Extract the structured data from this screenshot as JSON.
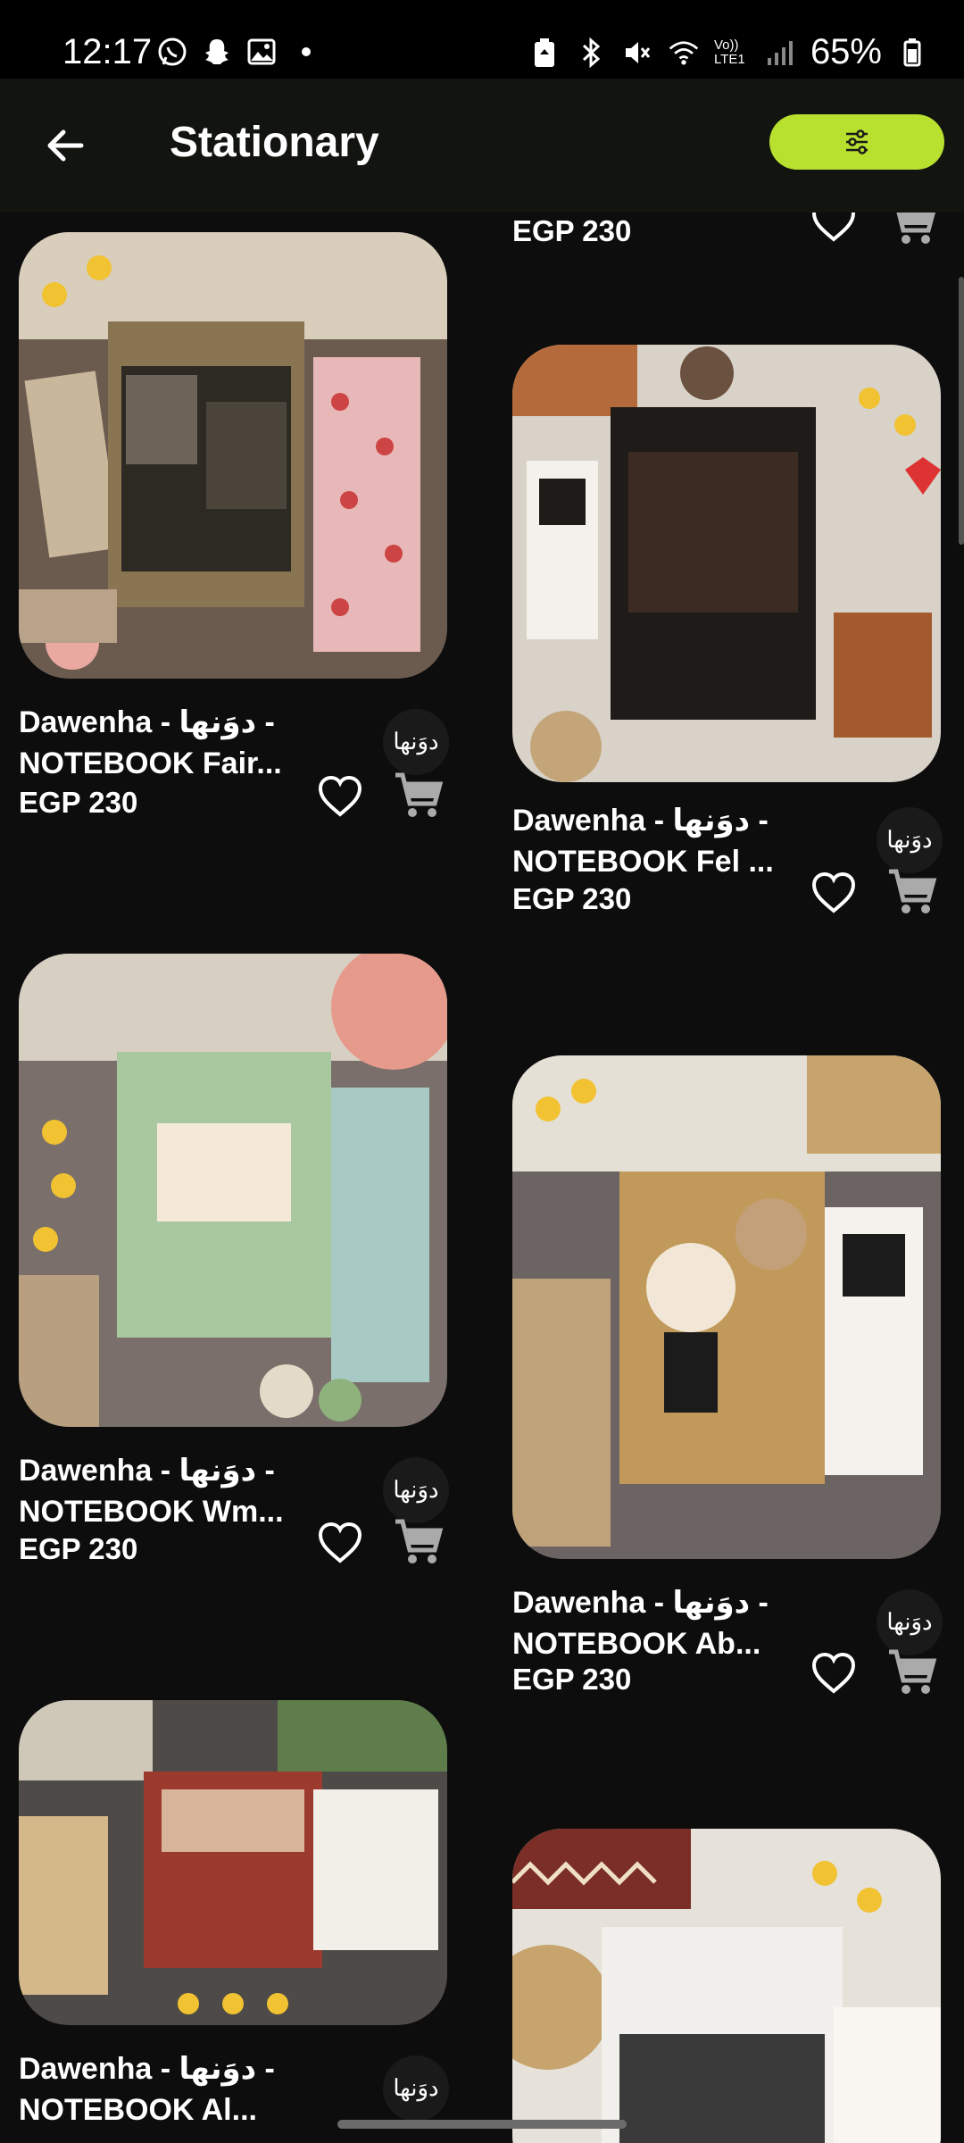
{
  "status_bar": {
    "time": "12:17",
    "left_icons": [
      "whatsapp-icon",
      "snapchat-icon",
      "gallery-icon",
      "dot-icon"
    ],
    "right_icons": [
      "battery-saver-icon",
      "bluetooth-icon",
      "mute-icon",
      "wifi-icon",
      "volte-icon",
      "signal-icon"
    ],
    "volte_label": "Vo)) LTE1",
    "battery": "65%"
  },
  "app_bar": {
    "title": "Stationary",
    "back_icon": "arrow-left-icon",
    "filter_icon": "sliders-icon",
    "accent": "#b8e02f"
  },
  "products": [
    {
      "name_line1": "Dawenha - دوَنها -",
      "name_line2": "NOTEBOOK Fair...",
      "price": "EGP 230",
      "logo_text": "دوَنها"
    },
    {
      "name_line1": "Dawenha - دوَنها -",
      "name_line2": "NOTEBOOK Fel ...",
      "price": "EGP 230",
      "logo_text": "دوَنها"
    },
    {
      "name_line1": "Dawenha - دوَنها -",
      "name_line2": "NOTEBOOK Wm...",
      "price": "EGP 230",
      "logo_text": "دوَنها"
    },
    {
      "name_line1": "Dawenha - دوَنها -",
      "name_line2": "NOTEBOOK  Ab...",
      "price": "EGP 230",
      "logo_text": "دوَنها"
    },
    {
      "name_line1": "Dawenha - دوَنها -",
      "name_line2": "NOTEBOOK Al...",
      "price": "",
      "logo_text": "دوَنها"
    }
  ],
  "partial_top_price": "EGP 230"
}
